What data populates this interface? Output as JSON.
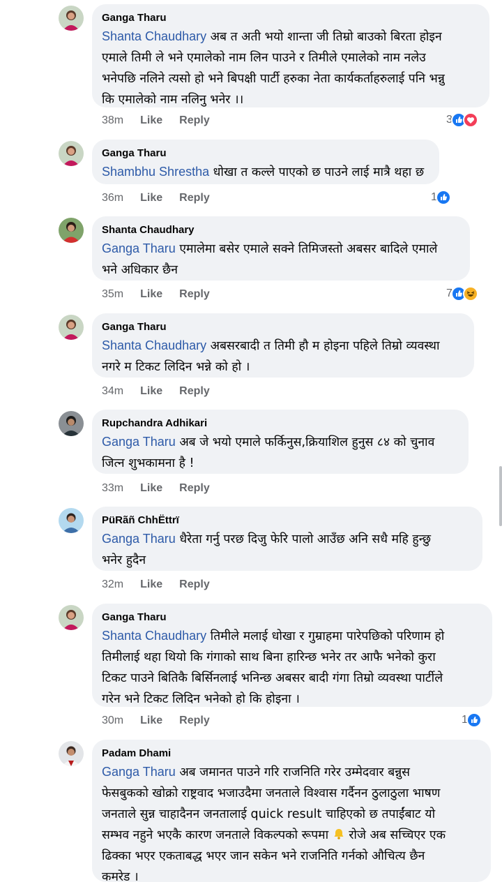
{
  "comments": [
    {
      "author": "Ganga Tharu",
      "mention": "Shanta Chaudhary",
      "lines": [
        " अब त अती भयो शान्ता जी तिम्रो बाउको बिरता होइन",
        "एमाले तिमी ले भने एमालेको नाम लिन पाउने र  तिमीले एमालेको नाम नलेउ",
        "भनेपछि नलिने त्यसो हो भने बिपक्षी पार्टी हरुका नेता कार्यकर्ताहरुलाई पनि भन्नु",
        "कि एमालेको नाम नलिनु भनेर ।।"
      ],
      "time": "38m",
      "like": "Like",
      "reply": "Reply",
      "react_count": "3",
      "react_icons": [
        "like-icon",
        "love-icon"
      ]
    },
    {
      "author": "Ganga Tharu",
      "mention": "Shambhu Shrestha",
      "lines": [
        " धोखा त कल्ले पाएको छ पाउने लाई मात्रै थहा छ"
      ],
      "time": "36m",
      "like": "Like",
      "reply": "Reply",
      "react_count": "1",
      "react_icons": [
        "like-icon"
      ]
    },
    {
      "author": "Shanta Chaudhary",
      "mention": "Ganga Tharu",
      "lines": [
        " एमालेमा बसेर एमाले सक्ने तिमिजस्तो अबसर बादिले एमाले",
        "भने अधिकार छैन"
      ],
      "time": "35m",
      "like": "Like",
      "reply": "Reply",
      "react_count": "7",
      "react_icons": [
        "like-icon",
        "haha-icon"
      ]
    },
    {
      "author": "Ganga Tharu",
      "mention": "Shanta Chaudhary",
      "lines": [
        " अबसरबादी त तिमी हौ म होइना पहिले तिम्रो व्यवस्था",
        "नगरे म टिकट लिदिन भन्ने को हो ।"
      ],
      "time": "34m",
      "like": "Like",
      "reply": "Reply",
      "react_count": "",
      "react_icons": []
    },
    {
      "author": "Rupchandra Adhikari",
      "mention": "Ganga Tharu",
      "lines": [
        " अब जे भयो एमाले फर्किनुस,क्रियाशिल हुनुस ८४ को चुनाव",
        "जित्न शुभकामना है !"
      ],
      "time": "33m",
      "like": "Like",
      "reply": "Reply",
      "react_count": "",
      "react_icons": []
    },
    {
      "author": "PüRãñ ChhËttrï",
      "mention": "Ganga Tharu",
      "lines": [
        " धैरेता गर्नु परछ दिजु फेरि पालो  आउँछ अनि सधै महि हुन्छु",
        "भनेर हुदैन"
      ],
      "time": "32m",
      "like": "Like",
      "reply": "Reply",
      "react_count": "",
      "react_icons": []
    },
    {
      "author": "Ganga Tharu",
      "mention": "Shanta Chaudhary",
      "lines": [
        " तिमीले मलाई धोखा र गुम्राहमा पारेपछिको परिणाम हो",
        "तिमीलाई थहा थियो कि गंगाको साथ बिना हारिन्छ भनेर तर आफै भनेको कुरा",
        "टिकट पाउने बितिकै बिर्सिनलाई भनिन्छ अबसर बादी गंगा तिम्रो व्यवस्था पार्टीले",
        "गरेन भने टिकट लिदिन भनेको हो कि होइना ।"
      ],
      "time": "30m",
      "like": "Like",
      "reply": "Reply",
      "react_count": "1",
      "react_icons": [
        "like-icon"
      ]
    },
    {
      "author": "Padam Dhami",
      "mention": "Ganga Tharu",
      "lines": [
        " अब जमानत पाउने गरि राजनिति गरेर उम्मेदवार बन्नुस",
        "फेसबुकको खोक्रो राष्ट्रवाद भजाउदैमा जनताले विश्वास गर्दैनन ठुलाठुला भाषण",
        "जनताले सुन्न चाहादैनन जनतालाई quick result चाहिएको छ तपाईंबाट यो",
        "सम्भव नहुने भएकै कारण जनताले विकल्पको रूपमा [bell] रोजे अब सच्चिएर एक",
        "ढिक्का भएर एकताबद्ध भएर जान सकेन भने राजनिति गर्नको औचित्य छैन",
        "कमरेड ।"
      ],
      "time": "",
      "like": "",
      "reply": "",
      "react_count": "",
      "react_icons": []
    }
  ]
}
